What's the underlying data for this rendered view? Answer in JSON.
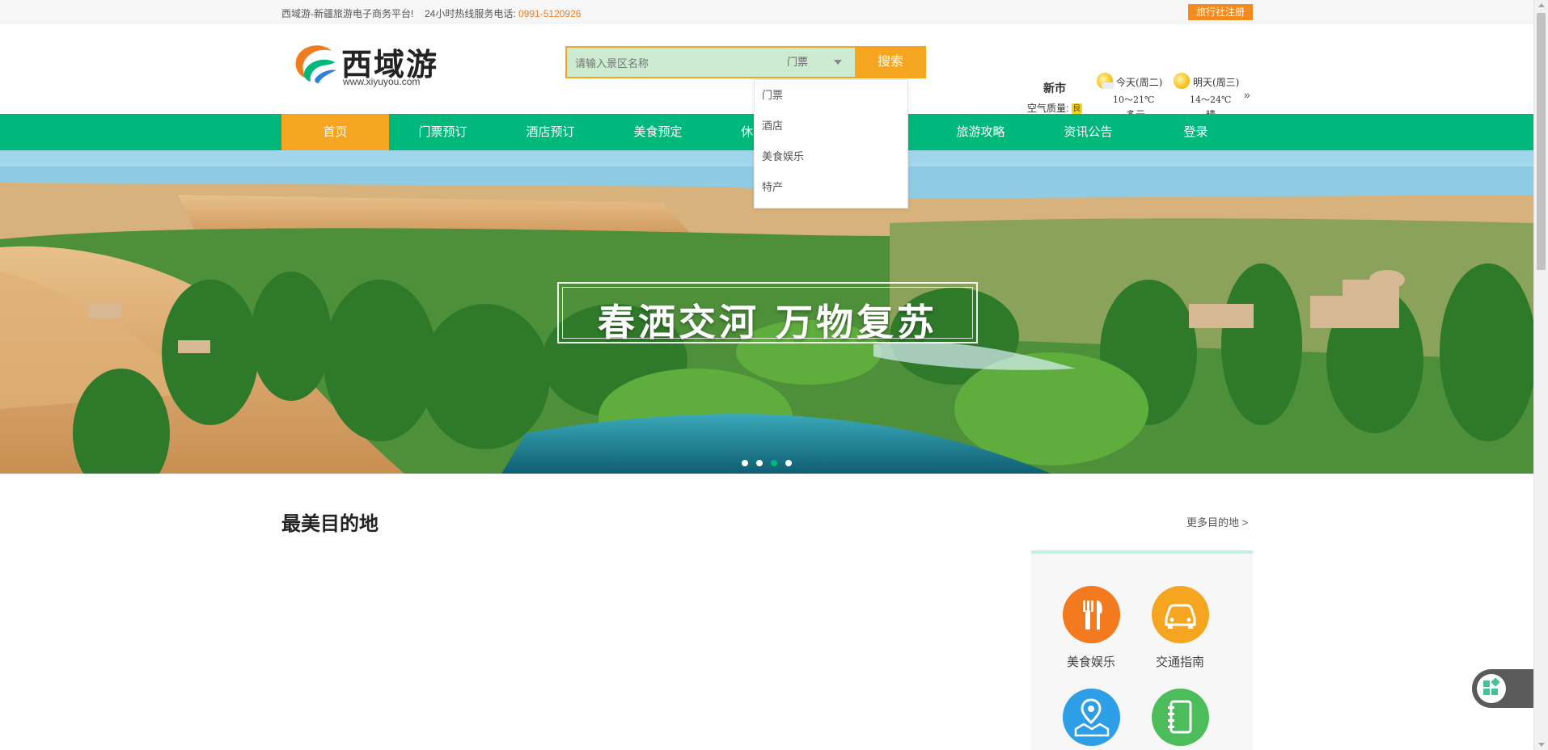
{
  "topbar": {
    "slogan": "西域游-新疆旅游电子商务平台!",
    "hotline_label": "24小时热线服务电话:",
    "hotline_number": "0991-5120926",
    "agency_register": "旅行社注册"
  },
  "logo": {
    "name": "西域游",
    "url_text": "www.xiyuyou.com"
  },
  "search": {
    "placeholder": "请输入景区名称",
    "selected_type": "门票",
    "button": "搜索",
    "options": [
      "门票",
      "酒店",
      "美食娱乐",
      "特产"
    ]
  },
  "weather": {
    "city": "新市",
    "air_quality_label": "空气质量:",
    "air_quality_value": "良",
    "days": [
      {
        "label": "今天(周二)",
        "temp": "10～21℃",
        "condition": "多云",
        "icon": "partly-cloudy-icon"
      },
      {
        "label": "明天(周三)",
        "temp": "14～24℃",
        "condition": "晴",
        "icon": "sunny-icon"
      }
    ],
    "more": "»"
  },
  "nav": {
    "items": [
      "首页",
      "门票预订",
      "酒店预订",
      "美食预定",
      "休",
      "",
      "旅游攻略",
      "资讯公告",
      "登录"
    ],
    "active_index": 0
  },
  "banner": {
    "caption": "春洒交河  万物复苏",
    "slide_count": 4,
    "active_slide": 2
  },
  "destinations": {
    "title": "最美目的地",
    "more": "更多目的地 >"
  },
  "services": [
    {
      "label": "美食娱乐",
      "icon": "fork-knife-icon",
      "color": "#f47a20"
    },
    {
      "label": "交通指南",
      "icon": "car-icon",
      "color": "#f5a51f"
    },
    {
      "label": "",
      "icon": "map-pin-icon",
      "color": "#2e9ee6"
    },
    {
      "label": "",
      "icon": "notebook-icon",
      "color": "#4cbd5a"
    }
  ],
  "colors": {
    "brand_green": "#00b87b",
    "accent_orange": "#f5a51f",
    "phone_orange": "#f07c1e"
  }
}
